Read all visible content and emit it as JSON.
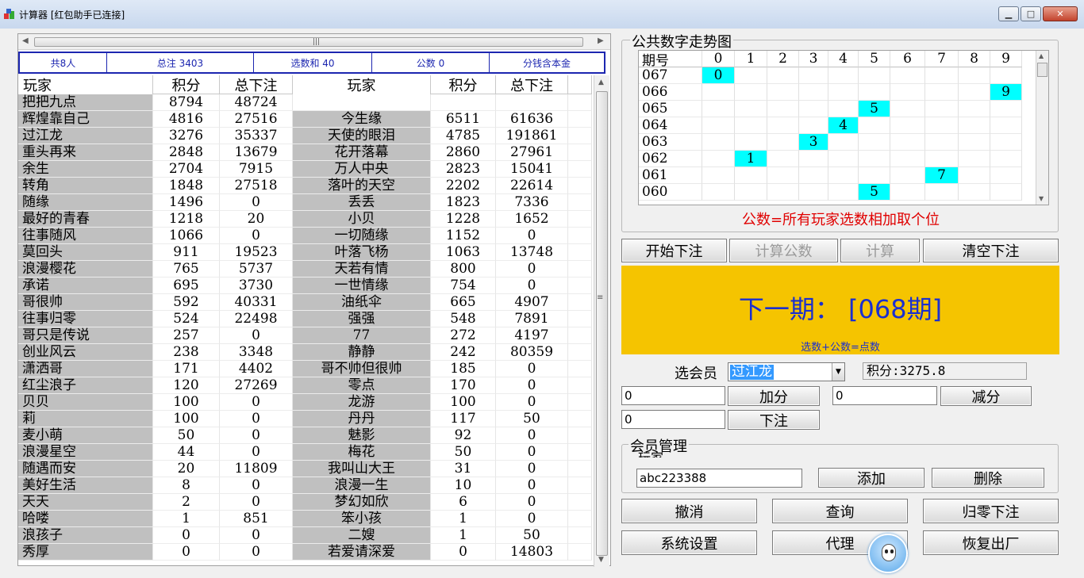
{
  "window": {
    "title": "计算器  [红包助手已连接]",
    "min_icon": "minimize-icon",
    "max_icon": "maximize-icon",
    "close_icon": "close-icon"
  },
  "summary": {
    "players": "共8人",
    "total": "总注  3403",
    "pick_sum": "选数和  40",
    "common": "公数  0",
    "split": "分钱含本金"
  },
  "grid": {
    "headers": [
      "玩家",
      "积分",
      "总下注",
      "玩家",
      "积分",
      "总下注"
    ],
    "rows": [
      [
        "把把九点",
        "8794",
        "48724",
        "",
        "",
        ""
      ],
      [
        "辉煌靠自己",
        "4816",
        "27516",
        "今生缘",
        "6511",
        "61636"
      ],
      [
        "过江龙",
        "3276",
        "35337",
        "天使的眼泪",
        "4785",
        "191861"
      ],
      [
        "重头再来",
        "2848",
        "13679",
        "花开落幕",
        "2860",
        "27961"
      ],
      [
        "余生",
        "2704",
        "7915",
        "万人中央",
        "2823",
        "15041"
      ],
      [
        "转角",
        "1848",
        "27518",
        "落叶的天空",
        "2202",
        "22614"
      ],
      [
        "随缘",
        "1496",
        "0",
        "丢丢",
        "1823",
        "7336"
      ],
      [
        "最好的青春",
        "1218",
        "20",
        "小贝",
        "1228",
        "1652"
      ],
      [
        "往事随风",
        "1066",
        "0",
        "一切随缘",
        "1152",
        "0"
      ],
      [
        "莫回头",
        "911",
        "19523",
        "叶落飞杨",
        "1063",
        "13748"
      ],
      [
        "浪漫樱花",
        "765",
        "5737",
        "天若有情",
        "800",
        "0"
      ],
      [
        "承诺",
        "695",
        "3730",
        "一世情缘",
        "754",
        "0"
      ],
      [
        "哥很帅",
        "592",
        "40331",
        "油纸伞",
        "665",
        "4907"
      ],
      [
        "往事归零",
        "524",
        "22498",
        "强强",
        "548",
        "7891"
      ],
      [
        "哥只是传说",
        "257",
        "0",
        "77",
        "272",
        "4197"
      ],
      [
        "创业风云",
        "238",
        "3348",
        "静静",
        "242",
        "80359"
      ],
      [
        "潇洒哥",
        "171",
        "4402",
        "哥不帅但很帅",
        "185",
        "0"
      ],
      [
        "红尘浪子",
        "120",
        "27269",
        "零点",
        "170",
        "0"
      ],
      [
        "贝贝",
        "100",
        "0",
        "龙游",
        "100",
        "0"
      ],
      [
        "莉",
        "100",
        "0",
        "丹丹",
        "117",
        "50"
      ],
      [
        "麦小萌",
        "50",
        "0",
        "魅影",
        "92",
        "0"
      ],
      [
        "浪漫星空",
        "44",
        "0",
        "梅花",
        "50",
        "0"
      ],
      [
        "随遇而安",
        "20",
        "11809",
        "我叫山大王",
        "31",
        "0"
      ],
      [
        "美好生活",
        "8",
        "0",
        "浪漫一生",
        "10",
        "0"
      ],
      [
        "天天",
        "2",
        "0",
        "梦幻如欣",
        "6",
        "0"
      ],
      [
        "哈喽",
        "1",
        "851",
        "笨小孩",
        "1",
        "0"
      ],
      [
        "浪孩子",
        "0",
        "0",
        "二嫂",
        "1",
        "50"
      ],
      [
        "秀厚",
        "0",
        "0",
        "若爱请深爱",
        "0",
        "14803"
      ]
    ]
  },
  "trend": {
    "legend": "公共数字走势图",
    "header_period": "期号",
    "digits": [
      "0",
      "1",
      "2",
      "3",
      "4",
      "5",
      "6",
      "7",
      "8",
      "9"
    ],
    "rows": [
      {
        "period": "067",
        "digit": 0
      },
      {
        "period": "066",
        "digit": 9
      },
      {
        "period": "065",
        "digit": 5
      },
      {
        "period": "064",
        "digit": 4
      },
      {
        "period": "063",
        "digit": 3
      },
      {
        "period": "062",
        "digit": 1
      },
      {
        "period": "061",
        "digit": 7
      },
      {
        "period": "060",
        "digit": 5
      }
    ],
    "formula": "公数=所有玩家选数相加取个位",
    "hit_color": "#00ffff"
  },
  "actions": {
    "start_bet": "开始下注",
    "calc_common": "计算公数",
    "calc": "计算",
    "clear_bet": "清空下注"
  },
  "next": {
    "title": "下一期：  [068期]",
    "note": "选数+公数=点数",
    "bg": "#f5c400",
    "fg": "#1a2fd0"
  },
  "member_select": {
    "label": "选会员",
    "selected": "过江龙",
    "score": "积分:3275.8"
  },
  "adjust": {
    "add_value": "0",
    "add_label": "加分",
    "sub_value": "0",
    "sub_label": "减分",
    "bet_value": "0",
    "bet_label": "下注"
  },
  "member_mgmt": {
    "legend": "会员管理",
    "sub_label": "玩家",
    "name_value": "abc223388",
    "add_label": "添加",
    "delete_label": "删除"
  },
  "bottom": {
    "undo": "撤消",
    "query": "查询",
    "reset_bet": "归零下注",
    "settings": "系统设置",
    "agent": "代理",
    "factory": "恢复出厂"
  }
}
